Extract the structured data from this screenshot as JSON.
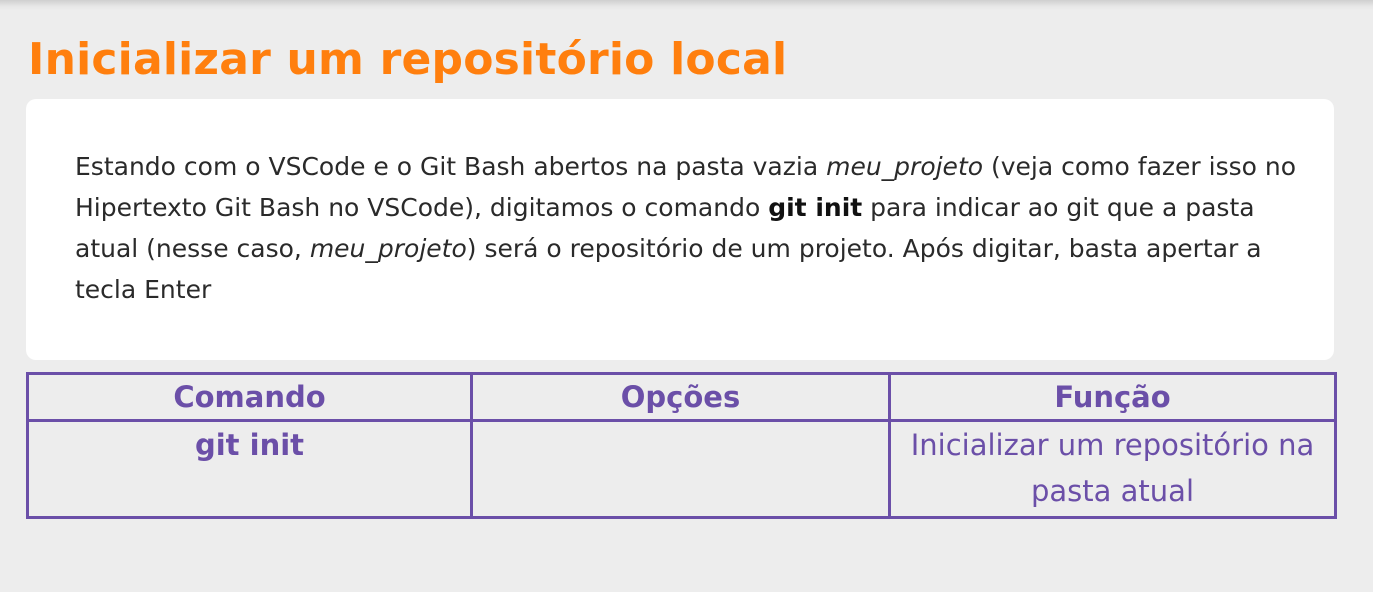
{
  "title": "Inicializar um repositório local",
  "card": {
    "text_1": "Estando com o VSCode e o Git Bash abertos na pasta vazia ",
    "text_2_em": "meu_projeto",
    "text_3": " (veja como fazer isso no Hipertexto Git Bash no VSCode), digitamos o comando ",
    "text_4_strong": "git init",
    "text_5": " para indicar ao git que a pasta atual (nesse caso, ",
    "text_6_em": "meu_projeto",
    "text_7": ") será o repositório de um projeto. Após digitar, basta apertar a tecla Enter"
  },
  "table": {
    "headers": [
      "Comando",
      "Opções",
      "Função"
    ],
    "rows": [
      {
        "comando": "git init",
        "opcoes": "",
        "funcao": "Inicializar um repositório na pasta atual"
      }
    ]
  },
  "colors": {
    "title": "#ff7f0e",
    "table_accent": "#6b4fa8",
    "background": "#ededed",
    "card": "#ffffff"
  }
}
